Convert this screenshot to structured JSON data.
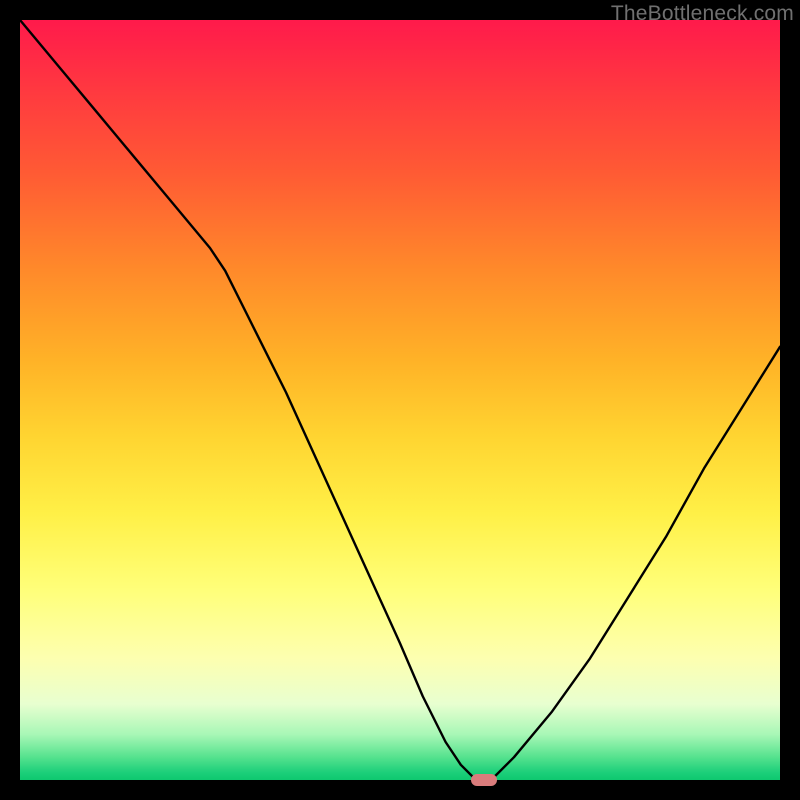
{
  "watermark_text": "TheBottleneck.com",
  "chart_data": {
    "type": "line",
    "title": "",
    "xlabel": "",
    "ylabel": "",
    "xlim": [
      0,
      100
    ],
    "ylim": [
      0,
      100
    ],
    "grid": false,
    "legend": false,
    "gradient_meaning": "background shifts from red (high bottleneck) at top to green (no bottleneck) at bottom",
    "series": [
      {
        "name": "bottleneck-curve",
        "x": [
          0,
          5,
          10,
          15,
          20,
          25,
          27,
          30,
          35,
          40,
          45,
          50,
          53,
          56,
          58,
          60,
          62,
          65,
          70,
          75,
          80,
          85,
          90,
          95,
          100
        ],
        "y": [
          100,
          94,
          88,
          82,
          76,
          70,
          67,
          61,
          51,
          40,
          29,
          18,
          11,
          5,
          2,
          0,
          0,
          3,
          9,
          16,
          24,
          32,
          41,
          49,
          57
        ]
      }
    ],
    "markers": [
      {
        "name": "optimal-point",
        "x": 61,
        "y": 0,
        "color": "#d97c7c"
      }
    ]
  }
}
